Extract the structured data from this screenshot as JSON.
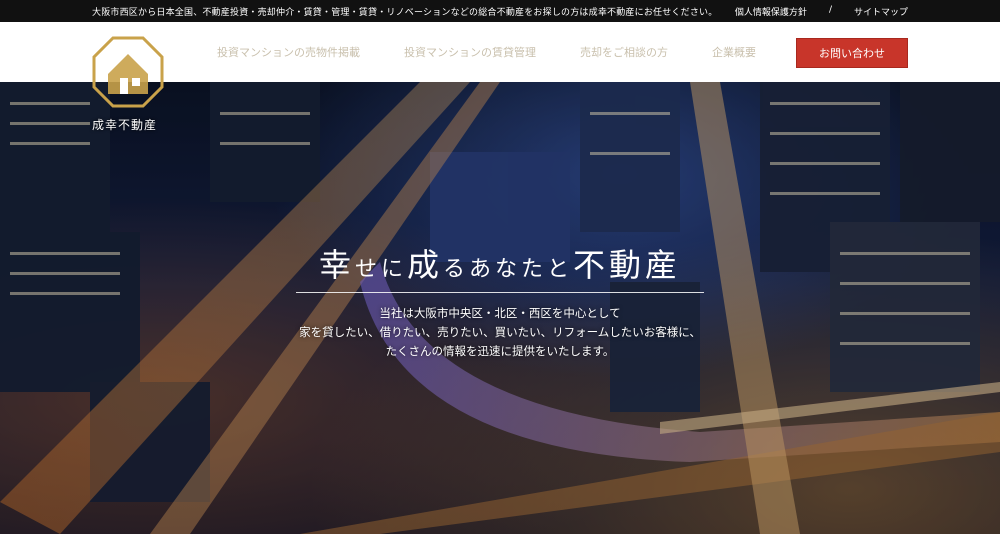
{
  "topbar": {
    "message": "大阪市西区から日本全国、不動産投資・売却仲介・賃貸・管理・賃貸・リノベーションなどの総合不動産をお探しの方は成幸不動産にお任せください。",
    "links": [
      {
        "label": "個人情報保護方針"
      },
      {
        "label": "サイトマップ"
      }
    ],
    "separator": "/"
  },
  "logo": {
    "text": "成幸不動産",
    "icon": "house-octagon-logo",
    "color": "#c9a24a"
  },
  "nav": {
    "items": [
      {
        "label": "投資マンションの売物件掲載"
      },
      {
        "label": "投資マンションの賃貸管理"
      },
      {
        "label": "売却をご相談の方"
      },
      {
        "label": "企業概要"
      }
    ],
    "contact_label": "お問い合わせ"
  },
  "hero": {
    "title_parts": [
      {
        "text": "幸",
        "size": "big"
      },
      {
        "text": "せに",
        "size": "small"
      },
      {
        "text": "成",
        "size": "big"
      },
      {
        "text": "るあなたと",
        "size": "small"
      },
      {
        "text": "不動産",
        "size": "big"
      }
    ],
    "copy": [
      "当社は大阪市中央区・北区・西区を中心として",
      "家を貸したい、借りたい、売りたい、買いたい、リフォームしたいお客様に、",
      "たくさんの情報を迅速に提供をいたします。"
    ]
  },
  "colors": {
    "accent": "#c8352a",
    "nav_text": "#c9c0ad",
    "gold": "#c9a24a"
  }
}
